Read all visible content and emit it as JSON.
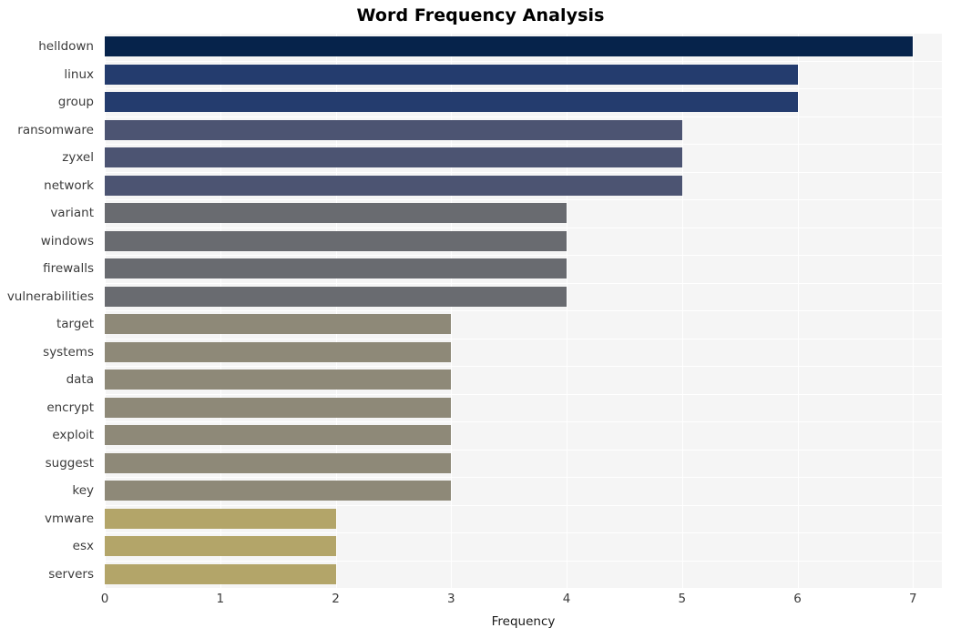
{
  "chart_data": {
    "type": "bar",
    "orientation": "horizontal",
    "title": "Word Frequency Analysis",
    "xlabel": "Frequency",
    "ylabel": "",
    "xlim": [
      0,
      7.25
    ],
    "xticks": [
      0,
      1,
      2,
      3,
      4,
      5,
      6,
      7
    ],
    "xtick_labels": [
      "0",
      "1",
      "2",
      "3",
      "4",
      "5",
      "6",
      "7"
    ],
    "grid": true,
    "legend": null,
    "categories": [
      "helldown",
      "linux",
      "group",
      "ransomware",
      "zyxel",
      "network",
      "variant",
      "windows",
      "firewalls",
      "vulnerabilities",
      "target",
      "systems",
      "data",
      "encrypt",
      "exploit",
      "suggest",
      "key",
      "vmware",
      "esx",
      "servers"
    ],
    "values": [
      7,
      6,
      6,
      5,
      5,
      5,
      4,
      4,
      4,
      4,
      3,
      3,
      3,
      3,
      3,
      3,
      3,
      2,
      2,
      2
    ],
    "bar_colors": [
      "#06234b",
      "#243c6e",
      "#243c6e",
      "#4c5472",
      "#4c5472",
      "#4c5472",
      "#696b70",
      "#696b70",
      "#696b70",
      "#696b70",
      "#8e8978",
      "#8e8978",
      "#8e8978",
      "#8e8978",
      "#8e8978",
      "#8e8978",
      "#8e8978",
      "#b3a569",
      "#b3a569",
      "#b3a569"
    ]
  },
  "style": {
    "plot_background": "#f5f5f5",
    "figure_background": "#ffffff",
    "gridline_color": "#ffffff",
    "title_color": "#000000",
    "tick_color": "#3b3b3b"
  }
}
